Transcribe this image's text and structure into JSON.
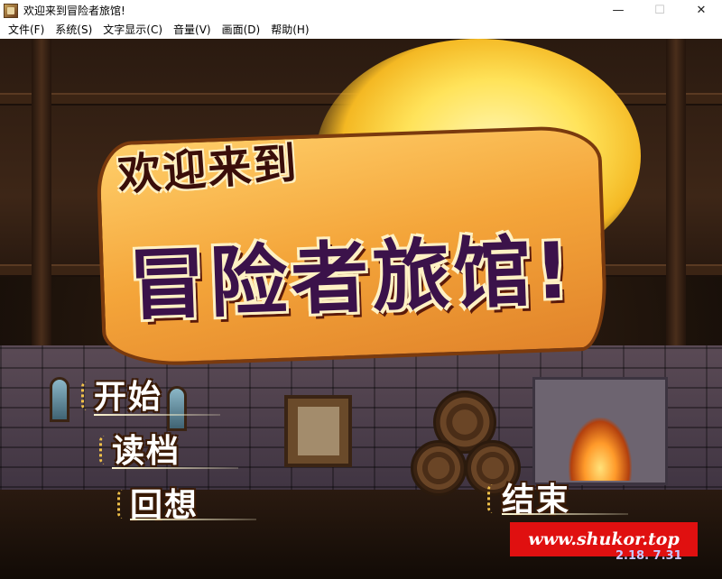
{
  "window": {
    "title": "欢迎来到冒险者旅馆!",
    "minimize": "—",
    "maximize": "☐",
    "close": "✕"
  },
  "menubar": {
    "items": [
      "文件(F)",
      "系统(S)",
      "文字显示(C)",
      "音量(V)",
      "画面(D)",
      "帮助(H)"
    ]
  },
  "game": {
    "logo_line1": "欢迎来到",
    "logo_line2": "冒险者旅馆!",
    "options": {
      "start": "开始",
      "load": "读档",
      "recollection": "回想",
      "exit": "结束"
    },
    "version": "2.18. 7.31",
    "watermark": "www.shukor.top"
  },
  "colors": {
    "logo_orange": "#f4a53a",
    "logo_purple": "#3b124a",
    "watermark_red": "#e01010"
  }
}
